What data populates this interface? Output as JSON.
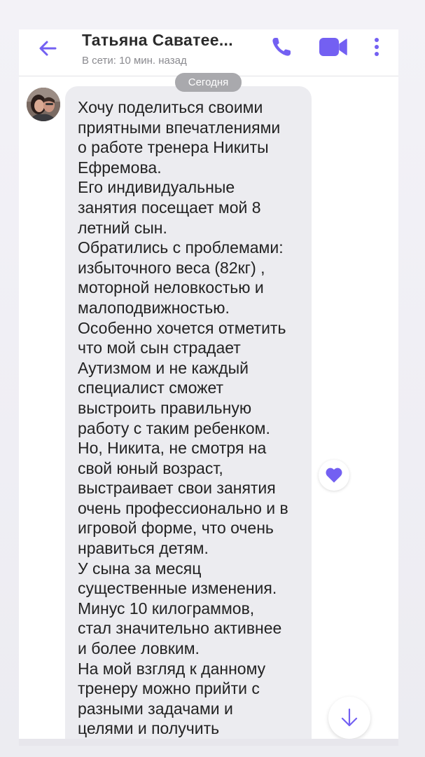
{
  "header": {
    "contact_name": "Татьяна Саватее...",
    "status": "В сети: 10 мин. назад"
  },
  "chat": {
    "date_separator": "Сегодня",
    "message": {
      "text": "Хочу поделиться своими\nприятными впечатлениями\nо работе тренера Никиты\nЕфремова.\nЕго индивидуальные\nзанятия посещает мой 8\nлетний сын.\nОбратились с проблемами:\nизбыточного веса (82кг) ,\nмоторной неловкостью и\nмалоподвижностью.\nОсобенно хочется отметить\nчто мой сын страдает\nАутизмом и не каждый\nспециалист сможет\nвыстроить правильную\nработу с таким ребенком.\nНо, Никита, не смотря на\nсвой юный возраст,\nвыстраивает свои занятия\nочень профессионально и в\nигровой форме, что очень\nнравиться детям.\nУ сына за месяц\nсущественные изменения.\nМинус 10 килограммов,\nстал значительно активнее\nи более ловким.\nНа мой взгляд к данному\nтренеру можно прийти с\nразными задачами и\nцелями и получить",
      "liked": true
    }
  },
  "icons": {
    "back": "back-arrow-icon",
    "call": "phone-icon",
    "video": "video-camera-icon",
    "more": "more-vertical-icon",
    "like": "heart-icon",
    "scroll_down": "arrow-down-icon"
  },
  "colors": {
    "accent": "#7360f2",
    "bubble": "#ececf0",
    "date_pill": "#a9a9ad"
  }
}
